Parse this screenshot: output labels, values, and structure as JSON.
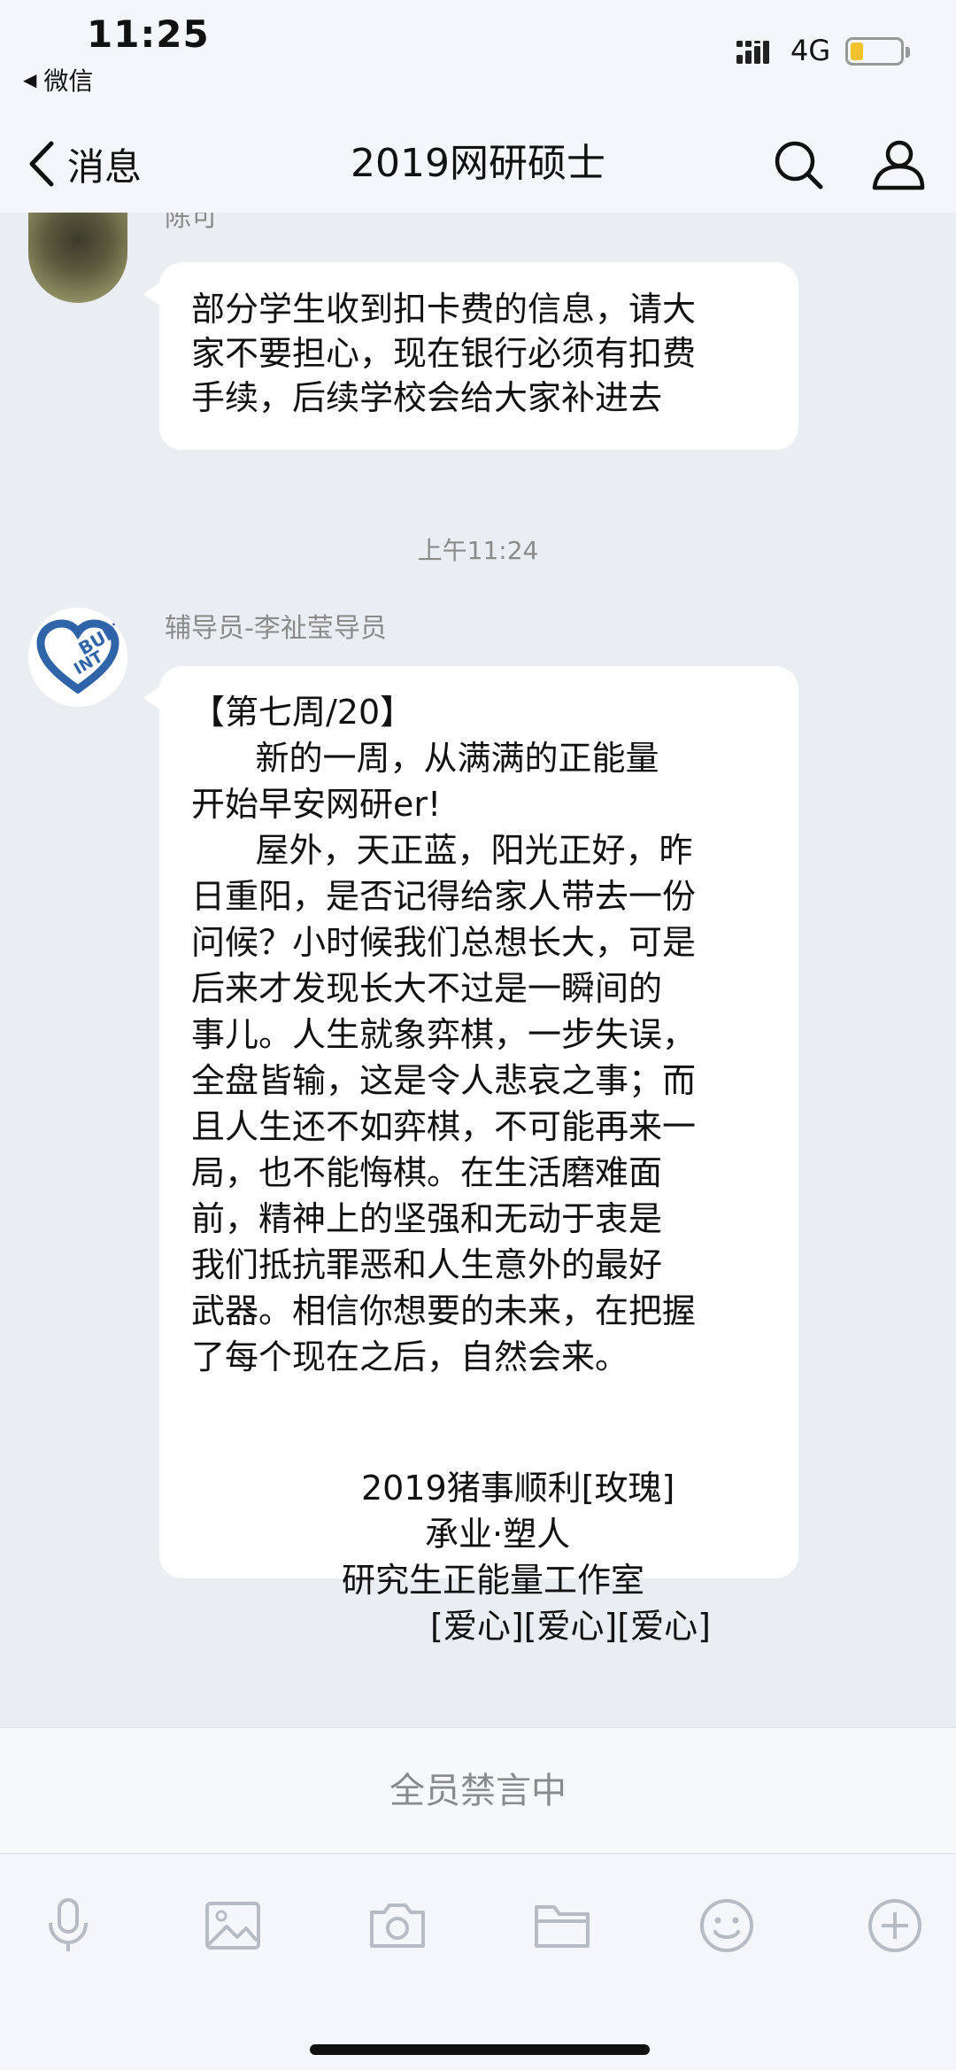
{
  "status_bar": {
    "time": "11:25",
    "back_app": "微信",
    "network": "4G",
    "battery_level": 0.25,
    "battery_color": "#f2c230"
  },
  "nav": {
    "back_label": "消息",
    "title": "2019网研硕士",
    "back_icon": "chevron-left-icon",
    "search_icon": "search-icon",
    "profile_icon": "group-profile-icon"
  },
  "messages": [
    {
      "sender": "陈可",
      "lines": [
        "部分学生收到扣卡费的信息，请大",
        "家不要担心，现在银行必须有扣费",
        "手续，后续学校会给大家补进去"
      ]
    },
    {
      "sender": "辅导员-李祉莹导员",
      "lines": [
        "【第七周/20】",
        "      新的一周，从满满的正能量",
        "开始早安网研er!",
        "      屋外，天正蓝，阳光正好，昨",
        "日重阳，是否记得给家人带去一份",
        "问候？小时候我们总想长大，可是",
        "后来才发现长大不过是一瞬间的",
        "事儿。人生就象弈棋，一步失误，",
        "全盘皆输，这是令人悲哀之事；而",
        "且人生还不如弈棋，不可能再来一",
        "局，也不能悔棋。在生活磨难面",
        "前，精神上的坚强和无动于衷是",
        "我们抵抗罪恶和人生意外的最好",
        "武器。相信你想要的未来，在把握",
        "了每个现在之后，自然会来。"
      ],
      "signature": [
        "2019猪事顺利[玫瑰]",
        "承业·塑人",
        "研究生正能量工作室",
        "[爱心][爱心][爱心]"
      ],
      "avatar_text": [
        "BUPT",
        "INT"
      ]
    }
  ],
  "timestamp": "上午11:24",
  "muted_label": "全员禁言中",
  "toolbar": {
    "icons": [
      "microphone-icon",
      "image-icon",
      "camera-icon",
      "folder-icon",
      "emoji-icon",
      "plus-icon"
    ]
  }
}
